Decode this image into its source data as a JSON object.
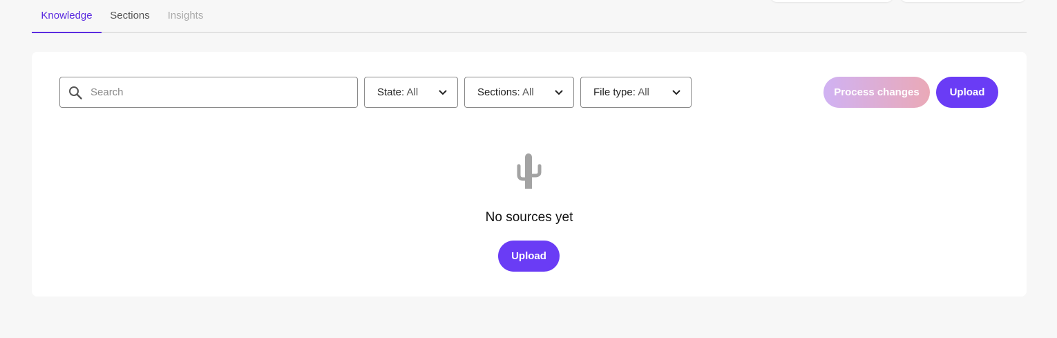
{
  "tabs": [
    {
      "label": "Knowledge",
      "active": true
    },
    {
      "label": "Sections",
      "active": false
    },
    {
      "label": "Insights",
      "active": false
    }
  ],
  "search": {
    "placeholder": "Search",
    "value": ""
  },
  "filters": [
    {
      "label": "State:",
      "value": "All"
    },
    {
      "label": "Sections:",
      "value": "All"
    },
    {
      "label": "File type:",
      "value": "All"
    }
  ],
  "actions": {
    "process_label": "Process changes",
    "upload_label": "Upload"
  },
  "empty_state": {
    "title": "No sources yet",
    "upload_label": "Upload",
    "icon": "cactus-icon"
  },
  "colors": {
    "accent": "#6a3cf5",
    "active_tab": "#5b2ce0",
    "process_gradient_start": "#d0b2f3",
    "process_gradient_end": "#eaa9b7"
  }
}
